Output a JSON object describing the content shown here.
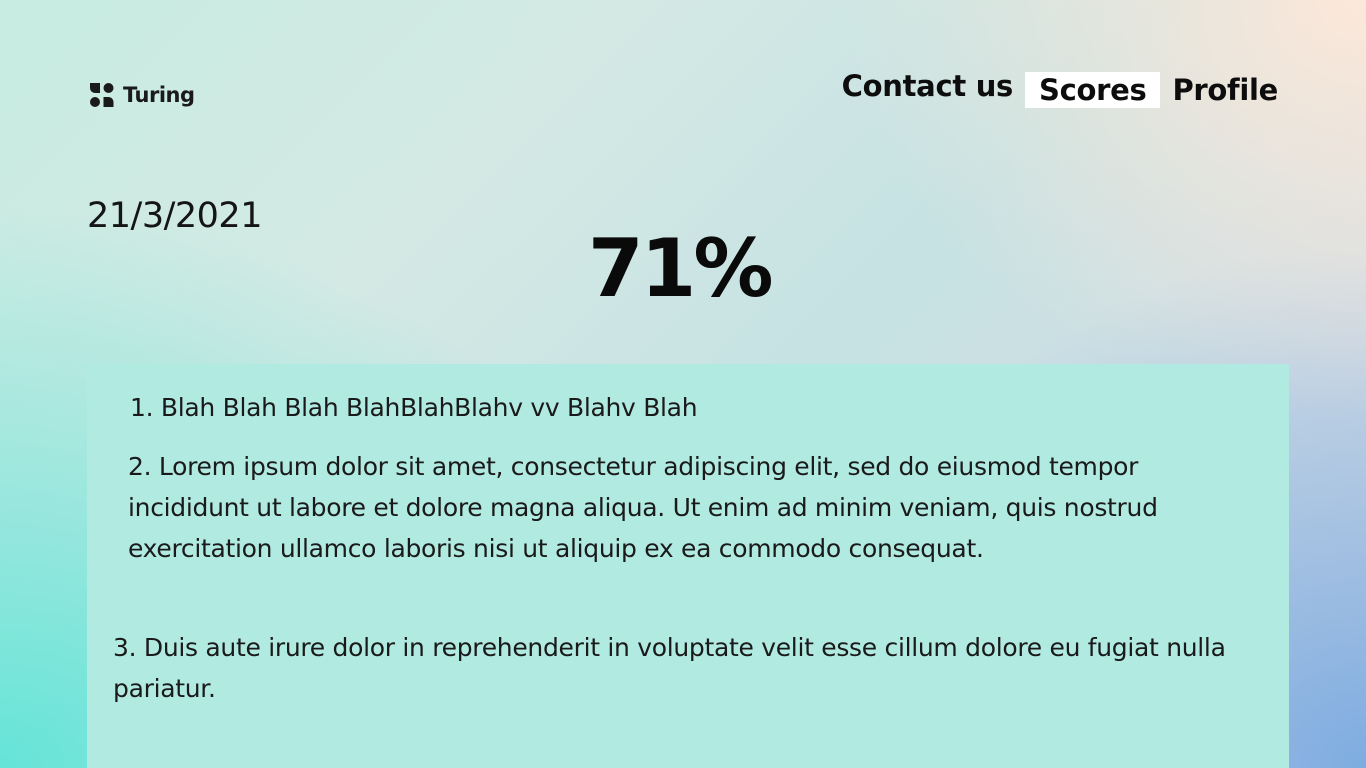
{
  "brand": {
    "name": "Turing",
    "icon": "turing-logo-icon"
  },
  "nav": {
    "contact": "Contact us",
    "scores": "Scores",
    "profile": "Profile",
    "active": "Scores"
  },
  "result": {
    "date": "21/3/2021",
    "score": "71%"
  },
  "feedback": {
    "items": [
      "1.  Blah Blah Blah BlahBlahBlahv vv Blahv Blah",
      "2. Lorem ipsum dolor sit amet, consectetur adipiscing elit, sed do eiusmod tempor incididunt ut labore et dolore magna aliqua. Ut enim ad minim veniam, quis nostrud exercitation ullamco laboris nisi ut aliquip ex ea commodo consequat.",
      "3. Duis aute irure dolor in reprehenderit in voluptate velit esse cillum dolore eu fugiat nulla pariatur."
    ]
  },
  "colors": {
    "panel": "#b1eae1",
    "active_nav_bg": "#ffffff",
    "text": "#111111"
  }
}
